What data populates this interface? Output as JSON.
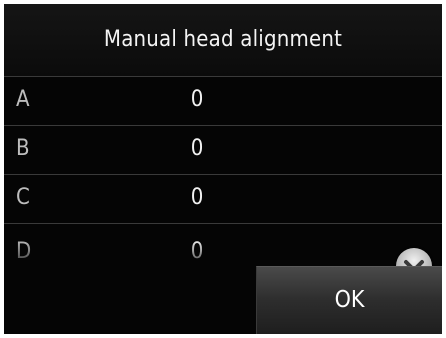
{
  "screen": {
    "title": "Manual head alignment"
  },
  "rows": [
    {
      "label": "A",
      "value": "0"
    },
    {
      "label": "B",
      "value": "0"
    },
    {
      "label": "C",
      "value": "0"
    },
    {
      "label": "D",
      "value": "0"
    }
  ],
  "controls": {
    "scroll_icon": "chevron-down-icon",
    "ok_label": "OK"
  }
}
